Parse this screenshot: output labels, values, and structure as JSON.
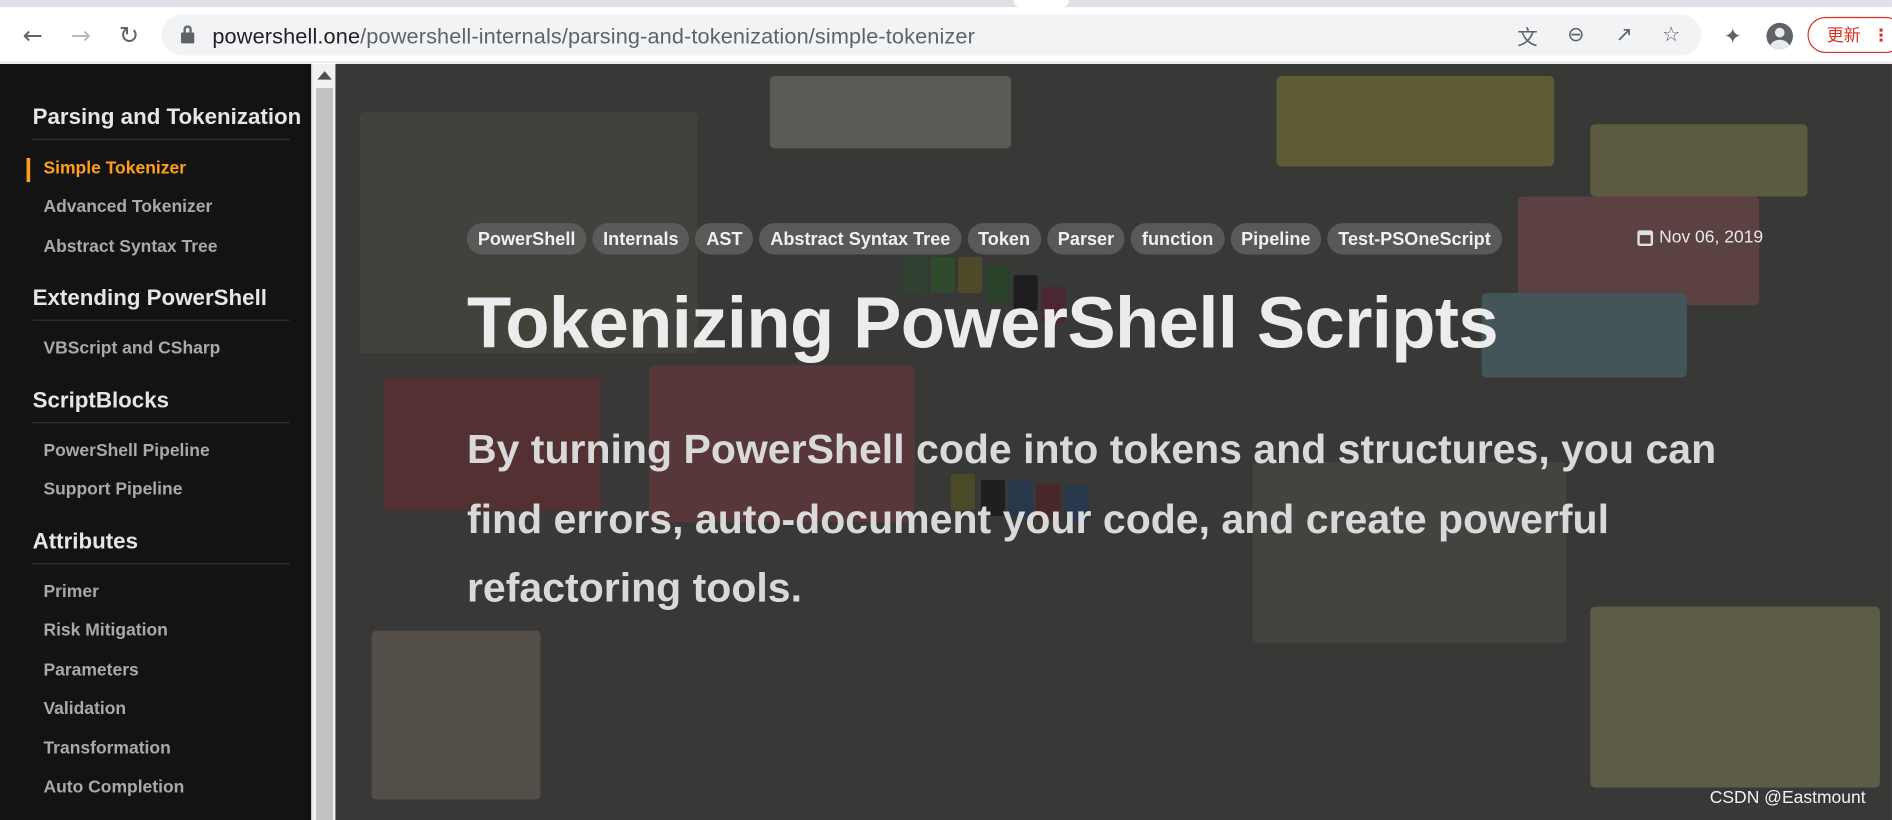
{
  "browser": {
    "url_host": "powershell.one",
    "url_path": "/powershell-internals/parsing-and-tokenization/simple-tokenizer",
    "update_label": "更新",
    "update_dots": "⋮",
    "icons": [
      "back-icon",
      "forward-icon",
      "reload-icon",
      "lock-icon",
      "translate-icon",
      "zoom-out-icon",
      "share-icon",
      "star-icon",
      "extensions-icon",
      "profile-icon"
    ]
  },
  "sidebar": {
    "sections": [
      {
        "title": "Parsing and Tokenization",
        "items": [
          {
            "label": "Simple Tokenizer",
            "active": true
          },
          {
            "label": "Advanced Tokenizer"
          },
          {
            "label": "Abstract Syntax Tree"
          }
        ]
      },
      {
        "title": "Extending PowerShell",
        "items": [
          {
            "label": "VBScript and CSharp"
          }
        ]
      },
      {
        "title": "ScriptBlocks",
        "items": [
          {
            "label": "PowerShell Pipeline"
          },
          {
            "label": "Support Pipeline"
          }
        ]
      },
      {
        "title": "Attributes",
        "items": [
          {
            "label": "Primer"
          },
          {
            "label": "Risk Mitigation"
          },
          {
            "label": "Parameters"
          },
          {
            "label": "Validation"
          },
          {
            "label": "Transformation"
          },
          {
            "label": "Auto Completion"
          }
        ]
      }
    ]
  },
  "article": {
    "tags": [
      "PowerShell",
      "Internals",
      "AST",
      "Abstract Syntax Tree",
      "Token",
      "Parser",
      "function",
      "Pipeline",
      "Test-PSOneScript"
    ],
    "date": "Nov 06, 2019",
    "title": "Tokenizing PowerShell Scripts",
    "lead": "By turning PowerShell code into tokens and structures, you can find errors, auto-document your code, and create powerful refactoring tools."
  },
  "watermark": "CSDN @Eastmount",
  "colors": {
    "accent": "#ff9f1a",
    "sidebar_bg": "#131313",
    "update_red": "#d93025"
  }
}
